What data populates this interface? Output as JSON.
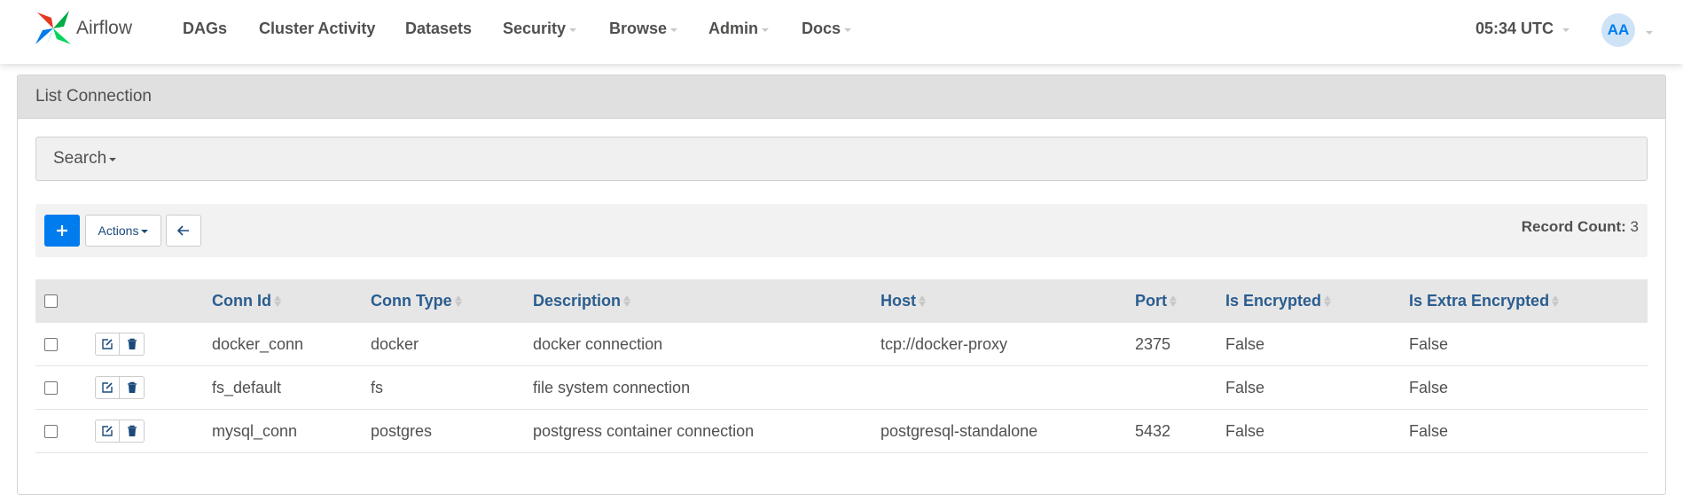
{
  "brand": {
    "name": "Airflow"
  },
  "nav": {
    "items": [
      {
        "label": "DAGs",
        "dropdown": false
      },
      {
        "label": "Cluster Activity",
        "dropdown": false
      },
      {
        "label": "Datasets",
        "dropdown": false
      },
      {
        "label": "Security",
        "dropdown": true
      },
      {
        "label": "Browse",
        "dropdown": true
      },
      {
        "label": "Admin",
        "dropdown": true
      },
      {
        "label": "Docs",
        "dropdown": true
      }
    ],
    "clock": "05:34 UTC",
    "user_initials": "AA"
  },
  "panel": {
    "title": "List Connection",
    "search_label": "Search",
    "actions_label": "Actions",
    "record_count_label": "Record Count:",
    "record_count": "3"
  },
  "table": {
    "columns": [
      "Conn Id",
      "Conn Type",
      "Description",
      "Host",
      "Port",
      "Is Encrypted",
      "Is Extra Encrypted"
    ],
    "rows": [
      [
        "docker_conn",
        "docker",
        "docker connection",
        "tcp://docker-proxy",
        "2375",
        "False",
        "False"
      ],
      [
        "fs_default",
        "fs",
        "file system connection",
        "",
        "",
        "False",
        "False"
      ],
      [
        "mysql_conn",
        "postgres",
        "postgress container connection",
        "postgresql-standalone",
        "5432",
        "False",
        "False"
      ]
    ]
  },
  "colors": {
    "primary": "#017cee",
    "header_link": "#2a5d8f",
    "text": "#51504f"
  },
  "icons": [
    "airflow-logo-icon",
    "plus-icon",
    "arrow-left-icon",
    "edit-icon",
    "trash-icon",
    "sort-icon",
    "chevron-down-icon"
  ]
}
